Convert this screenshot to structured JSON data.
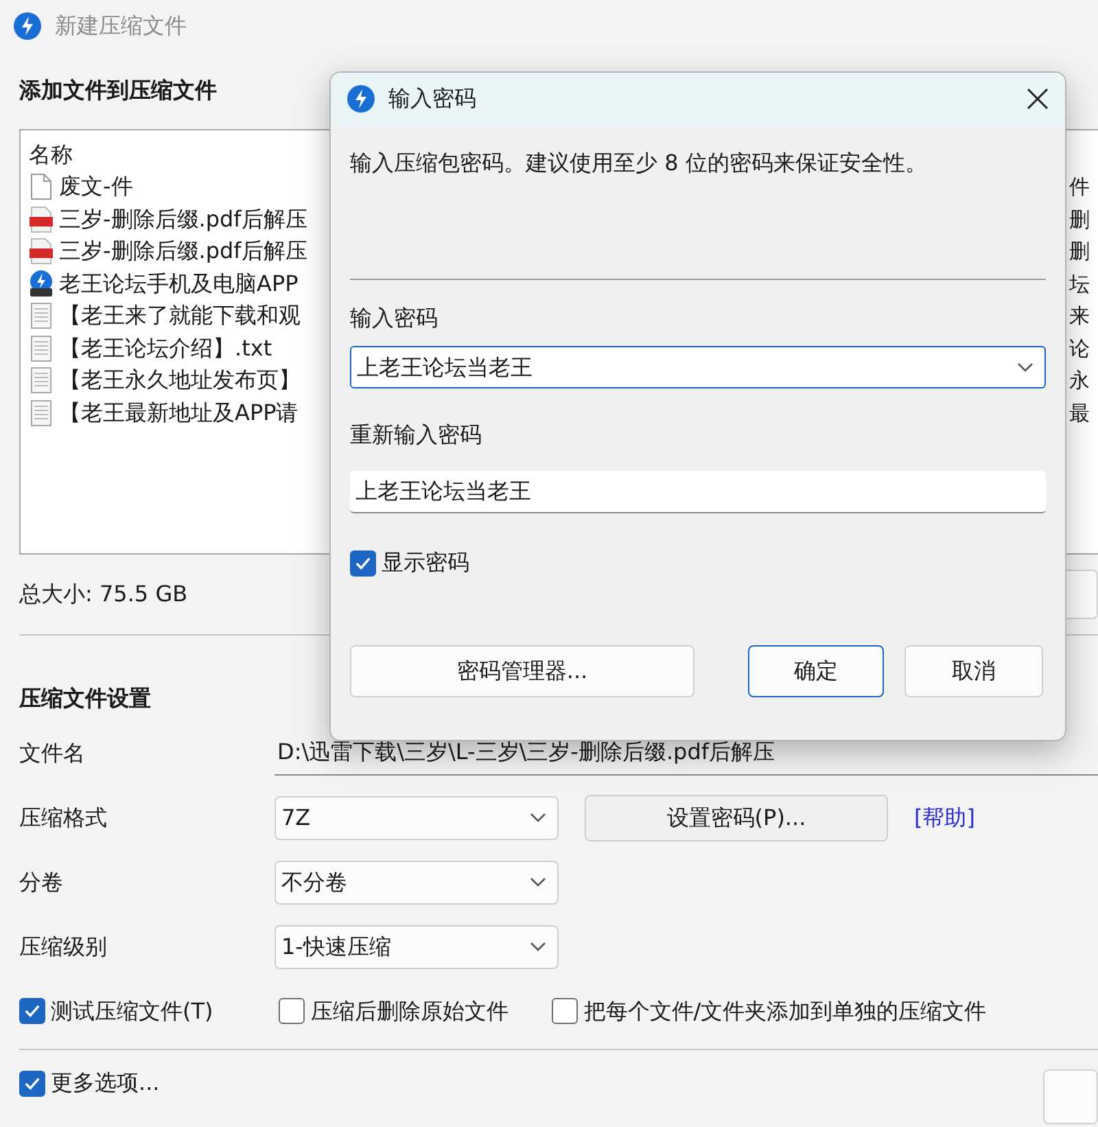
{
  "window": {
    "title": "新建压缩文件"
  },
  "files": {
    "heading": "添加文件到压缩文件",
    "column_1": "名称",
    "rows": [
      {
        "kind": "blank",
        "name": "废文-件",
        "column_2": "件"
      },
      {
        "kind": "pdf",
        "name": "三岁-删除后缀.pdf后解压",
        "column_2": "删"
      },
      {
        "kind": "pdf",
        "name": "三岁-删除后缀.pdf后解压",
        "column_2": "删"
      },
      {
        "kind": "archive",
        "name": "老王论坛手机及电脑APP",
        "column_2": "坛"
      },
      {
        "kind": "text",
        "name": "【老王来了就能下载和观",
        "column_2": "来"
      },
      {
        "kind": "text",
        "name": "【老王论坛介绍】.txt",
        "column_2": "论"
      },
      {
        "kind": "text",
        "name": "【老王永久地址发布页】",
        "column_2": "永"
      },
      {
        "kind": "text",
        "name": "【老王最新地址及APP请",
        "column_2": "最"
      }
    ],
    "total_size": "总大小: 75.5 GB"
  },
  "settings": {
    "heading": "压缩文件设置",
    "file_name": {
      "label": "文件名",
      "value": "D:\\迅雷下载\\三岁\\L-三岁\\三岁-删除后缀.pdf后解压"
    },
    "format": {
      "label": "压缩格式",
      "value": "7Z"
    },
    "set_password_button": "设置密码(P)...",
    "help_link": "[帮助]",
    "volume": {
      "label": "分卷",
      "value": "不分卷"
    },
    "compression_level": {
      "label": "压缩级别",
      "value": "1-快速压缩"
    },
    "options": [
      {
        "label": "测试压缩文件(T)",
        "checked": true
      },
      {
        "label": "压缩后删除原始文件",
        "checked": false
      },
      {
        "label": "把每个文件/文件夹添加到单独的压缩文件",
        "checked": false
      }
    ],
    "more_options": {
      "label": "更多选项...",
      "checked": true
    }
  },
  "dialog": {
    "title": "输入密码",
    "description": "输入压缩包密码。建议使用至少 8 位的密码来保证安全性。",
    "password": {
      "label": "输入密码",
      "value": "上老王论坛当老王"
    },
    "confirm": {
      "label": "重新输入密码",
      "value": "上老王论坛当老王"
    },
    "show_password": {
      "label": "显示密码",
      "checked": true
    },
    "buttons": [
      {
        "label": "密码管理器...",
        "kind": "normal"
      },
      {
        "label": "确定",
        "kind": "default"
      },
      {
        "label": "取消",
        "kind": "normal"
      }
    ]
  }
}
